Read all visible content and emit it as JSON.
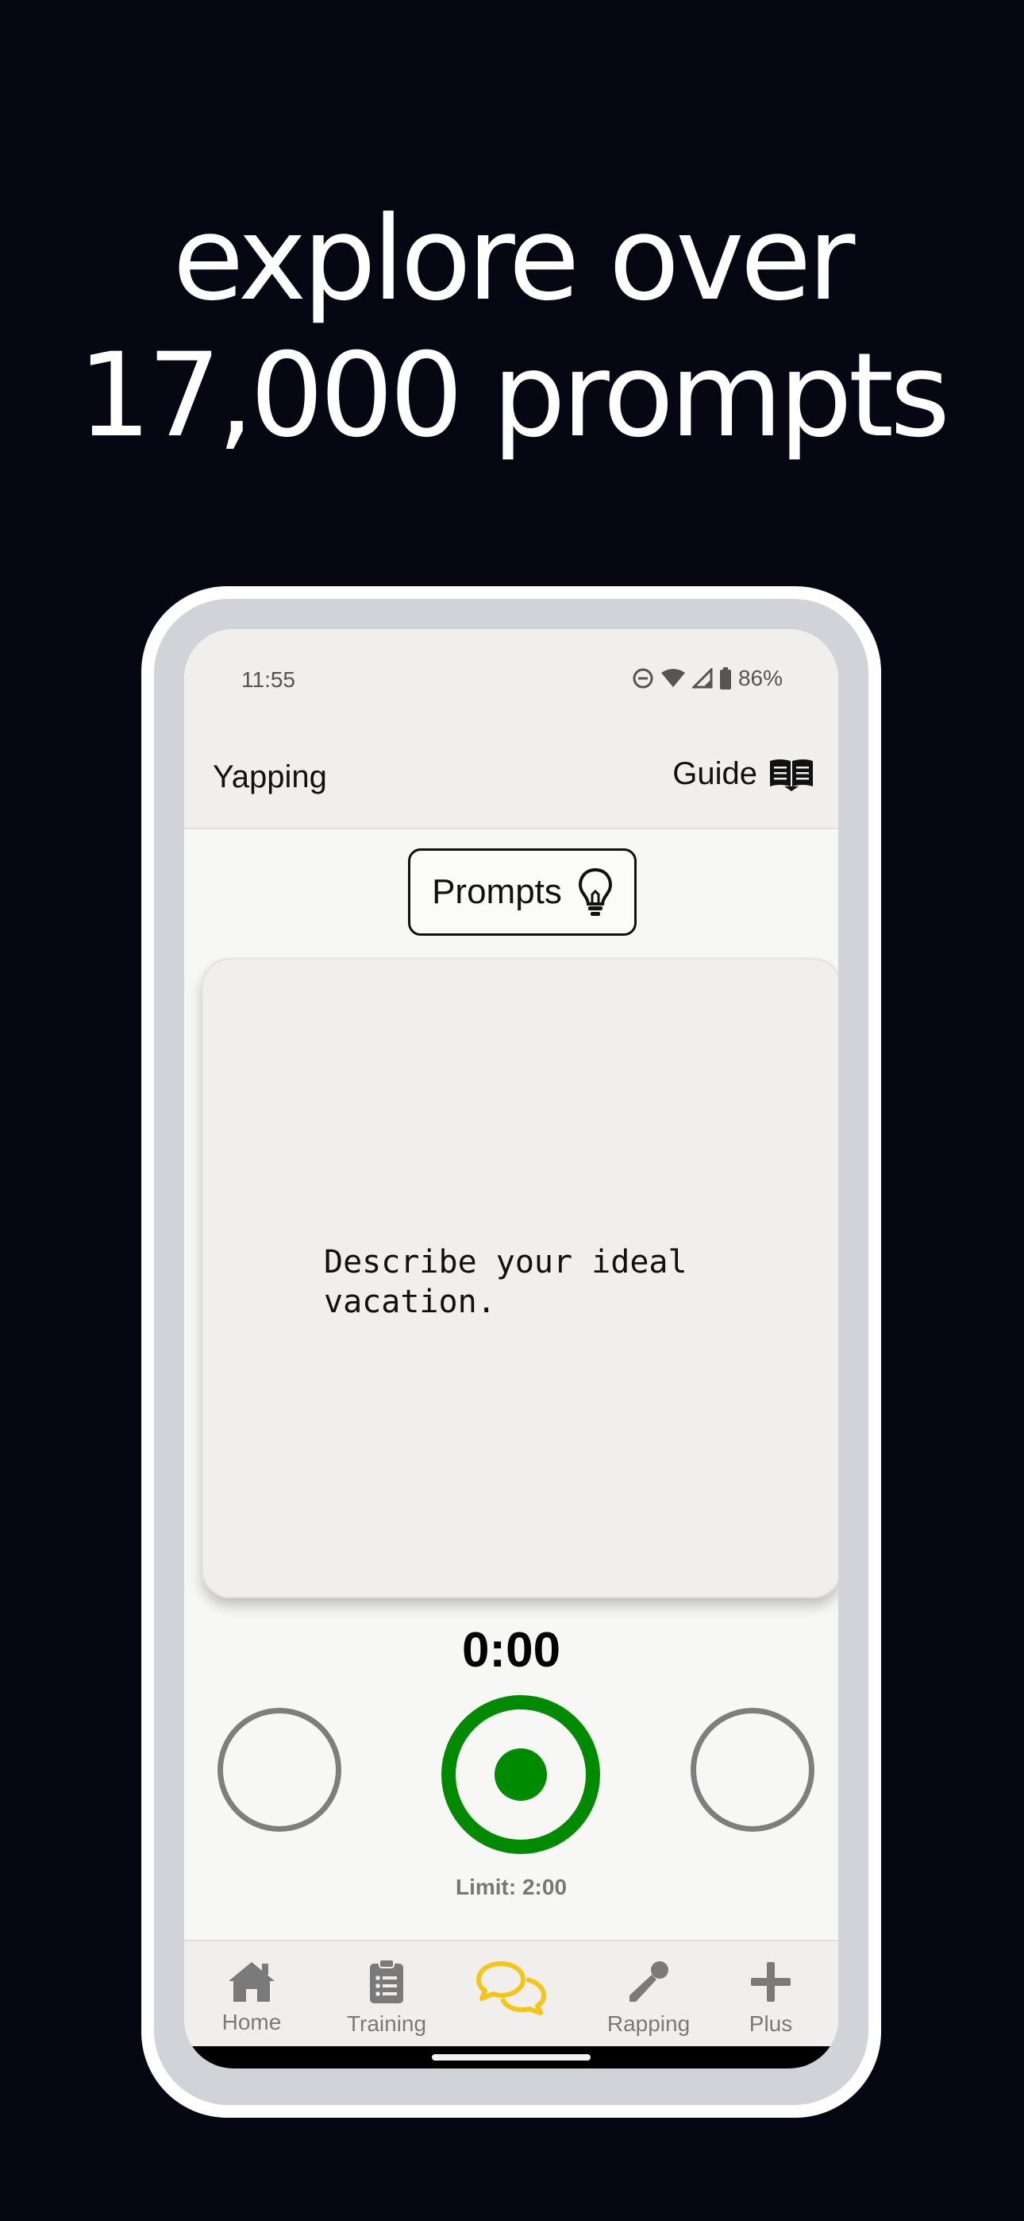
{
  "headline": {
    "line1": "explore over",
    "line2": "17,000 prompts"
  },
  "statusbar": {
    "time": "11:55",
    "battery": "86%",
    "icons": [
      "do-not-disturb-icon",
      "wifi-icon",
      "signal-icon",
      "battery-icon"
    ]
  },
  "appbar": {
    "title": "Yapping",
    "guide_label": "Guide",
    "guide_icon": "book-icon"
  },
  "prompts_button": {
    "label": "Prompts",
    "icon": "lightbulb-icon"
  },
  "prompt_card": {
    "text": "Describe your ideal vacation."
  },
  "recorder": {
    "timer": "0:00",
    "limit": "Limit: 2:00",
    "record_color": "#008a00"
  },
  "nav": {
    "items": [
      {
        "label": "Home",
        "icon": "home-icon"
      },
      {
        "label": "Training",
        "icon": "clipboard-list-icon"
      },
      {
        "label": "",
        "icon": "chat-bubbles-icon",
        "active": true
      },
      {
        "label": "Rapping",
        "icon": "microphone-icon"
      },
      {
        "label": "Plus",
        "icon": "plus-icon"
      }
    ],
    "active_color": "#f5c518"
  }
}
